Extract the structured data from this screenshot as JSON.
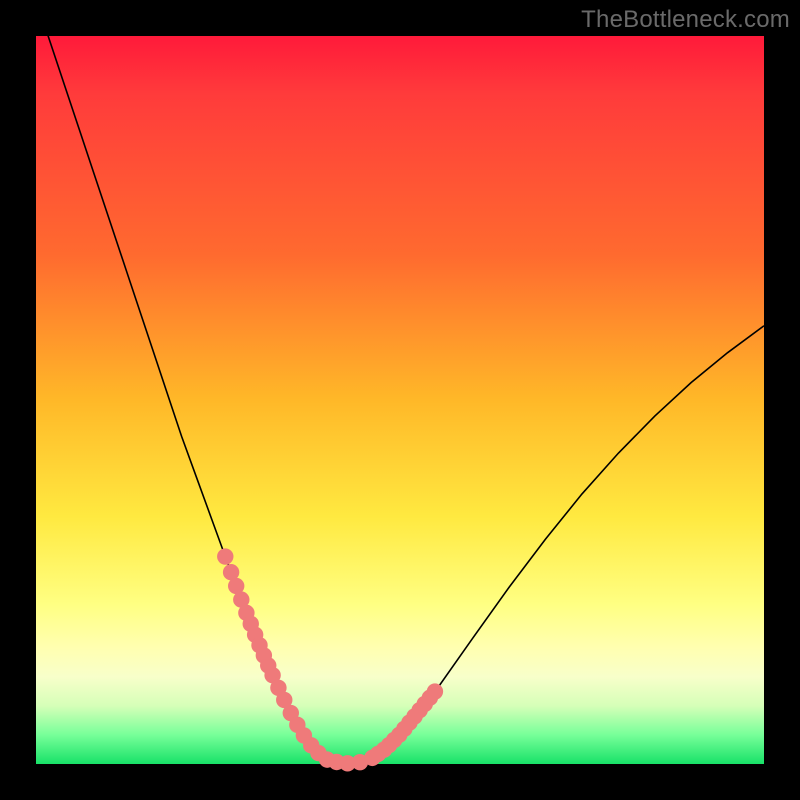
{
  "watermark": "TheBottleneck.com",
  "chart_data": {
    "type": "line",
    "title": "",
    "xlabel": "",
    "ylabel": "",
    "xlim": [
      0,
      100
    ],
    "ylim": [
      0,
      100
    ],
    "series": [
      {
        "name": "bottleneck-curve",
        "x": [
          0,
          2,
          4,
          6,
          8,
          10,
          12,
          14,
          16,
          18,
          20,
          22,
          24,
          26,
          27,
          28,
          29,
          30,
          31,
          32,
          33,
          34,
          35,
          36,
          37,
          38,
          39,
          40,
          42,
          44,
          46,
          48,
          50,
          55,
          60,
          65,
          70,
          75,
          80,
          85,
          90,
          95,
          100
        ],
        "y": [
          105,
          99,
          93,
          87,
          81,
          75,
          69,
          63,
          57,
          51,
          45,
          39.5,
          34,
          28.5,
          25.8,
          23.1,
          20.5,
          18,
          15.6,
          13.3,
          11.1,
          9,
          7,
          5.2,
          3.6,
          2.3,
          1.3,
          0.6,
          0.1,
          0.1,
          0.7,
          2.1,
          4.1,
          10.2,
          17.3,
          24.3,
          30.9,
          37.1,
          42.7,
          47.8,
          52.4,
          56.5,
          60.2
        ]
      }
    ],
    "sample_dots": {
      "name": "sample-points",
      "x": [
        26.0,
        26.8,
        27.5,
        28.2,
        28.9,
        29.5,
        30.1,
        30.7,
        31.3,
        31.9,
        32.5,
        33.3,
        34.1,
        35.0,
        35.9,
        36.8,
        37.8,
        38.8,
        40.0,
        41.3,
        42.8,
        44.5,
        46.2,
        47.0,
        47.8,
        48.5,
        49.2,
        49.9,
        50.6,
        51.3,
        52.0,
        52.7,
        53.4,
        54.1,
        54.8
      ],
      "y_source": "on-curve"
    },
    "gradient_stops": [
      {
        "pos": 0.0,
        "color": "#ff1a3a"
      },
      {
        "pos": 0.3,
        "color": "#ff6a2f"
      },
      {
        "pos": 0.5,
        "color": "#ffb828"
      },
      {
        "pos": 0.66,
        "color": "#ffe940"
      },
      {
        "pos": 0.84,
        "color": "#ffffb0"
      },
      {
        "pos": 0.92,
        "color": "#d6ffb8"
      },
      {
        "pos": 1.0,
        "color": "#18e268"
      }
    ]
  }
}
